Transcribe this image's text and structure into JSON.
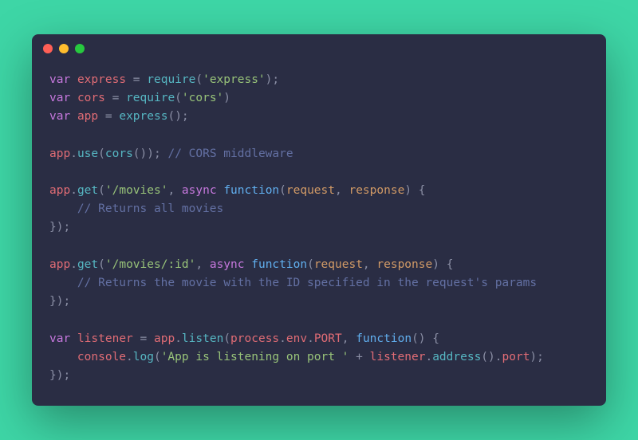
{
  "tokens": {
    "kw_var": "var",
    "kw_async": "async",
    "kw_function": "function",
    "id_express": "express",
    "id_cors": "cors",
    "id_app": "app",
    "id_listener": "listener",
    "id_process": "process",
    "id_env": "env",
    "id_PORT": "PORT",
    "id_console": "console",
    "fn_require": "require",
    "fn_use": "use",
    "fn_get": "get",
    "fn_listen": "listen",
    "fn_log": "log",
    "fn_address": "address",
    "prop_port": "port",
    "param_request": "request",
    "param_response": "response",
    "str_express": "'express'",
    "str_cors": "'cors'",
    "str_movies": "'/movies'",
    "str_movies_id": "'/movies/:id'",
    "str_listening": "'App is listening on port '",
    "comment_cors": "// CORS middleware",
    "comment_all": "// Returns all movies",
    "comment_id": "// Returns the movie with the ID specified in the request's params",
    "eq": " = ",
    "dot": ".",
    "comma": ", ",
    "op": "(",
    "cp": ")",
    "ob": "{",
    "cb": "}",
    "semi": ";",
    "plus": " + "
  }
}
